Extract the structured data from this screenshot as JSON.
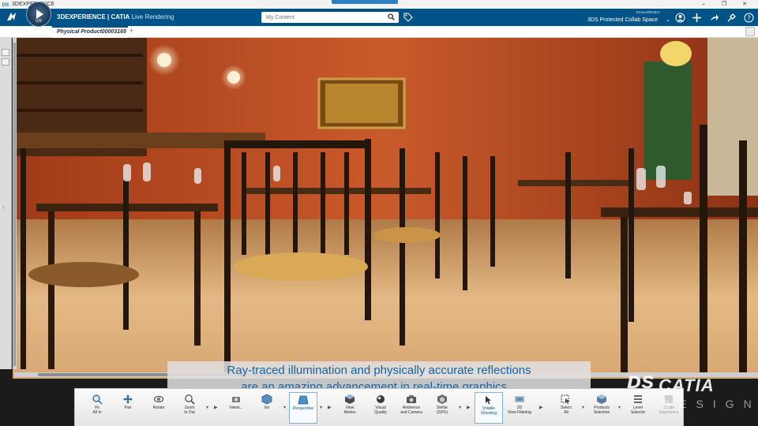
{
  "os_window": {
    "title": "3DEXPERIENCE",
    "controls": [
      "–",
      "❐",
      "✕"
    ]
  },
  "header": {
    "brand_prefix": "3DEXPERIENCE | CATIA",
    "app_name": "Live Rendering",
    "compass_label": "V,R",
    "search": {
      "placeholder": "My Content",
      "value": ""
    },
    "user_name": "Emna BRUEIA",
    "collab_space": "3DS Protected Collab Space",
    "icons": [
      "user-icon",
      "add-icon",
      "share-icon",
      "tools-icon",
      "help-icon"
    ],
    "accent_color": "#005386"
  },
  "tabs": [
    {
      "label": "Physical Product00003165",
      "active": true
    }
  ],
  "tab_add_label": "+",
  "caption": {
    "line1": "Ray-traced illumination and physically accurate reflections",
    "line2": "are an amazing advancement in real-time graphics...",
    "color": "#1565a8"
  },
  "action_bar": {
    "tools": [
      {
        "label": "Fit\nAll In",
        "icon": "fit-all-icon"
      },
      {
        "label": "Pan",
        "icon": "pan-icon"
      },
      {
        "label": "Rotate",
        "icon": "rotate-icon"
      },
      {
        "label": "Zoom\nIn Out",
        "icon": "zoom-icon"
      },
      {
        "label": "Views...",
        "icon": "views-icon"
      },
      {
        "label": "Iso",
        "icon": "iso-icon"
      },
      {
        "label": "Perspective",
        "icon": "perspective-icon",
        "active": true
      },
      {
        "label": "View\nModes",
        "icon": "view-modes-icon"
      },
      {
        "label": "Visual\nQuality",
        "icon": "visual-quality-icon"
      },
      {
        "label": "Ambience\nand Camera",
        "icon": "ambience-icon"
      },
      {
        "label": "Stellar\n(GPU)",
        "icon": "stellar-icon"
      },
      {
        "label": "Volatile\nGhosting",
        "icon": "ghosting-icon",
        "active": true
      },
      {
        "label": "3D\nView Filtering",
        "icon": "filter-icon"
      },
      {
        "label": "Select\nAll",
        "icon": "select-all-icon"
      },
      {
        "label": "Products\nSelection",
        "icon": "products-selection-icon"
      },
      {
        "label": "Level\nSelector",
        "icon": "level-selector-icon"
      },
      {
        "label": "Single\nExperience",
        "icon": "single-experience-icon",
        "faded": true
      }
    ]
  },
  "watermark": {
    "brand": "CATIA",
    "sub": "DESIGN"
  }
}
